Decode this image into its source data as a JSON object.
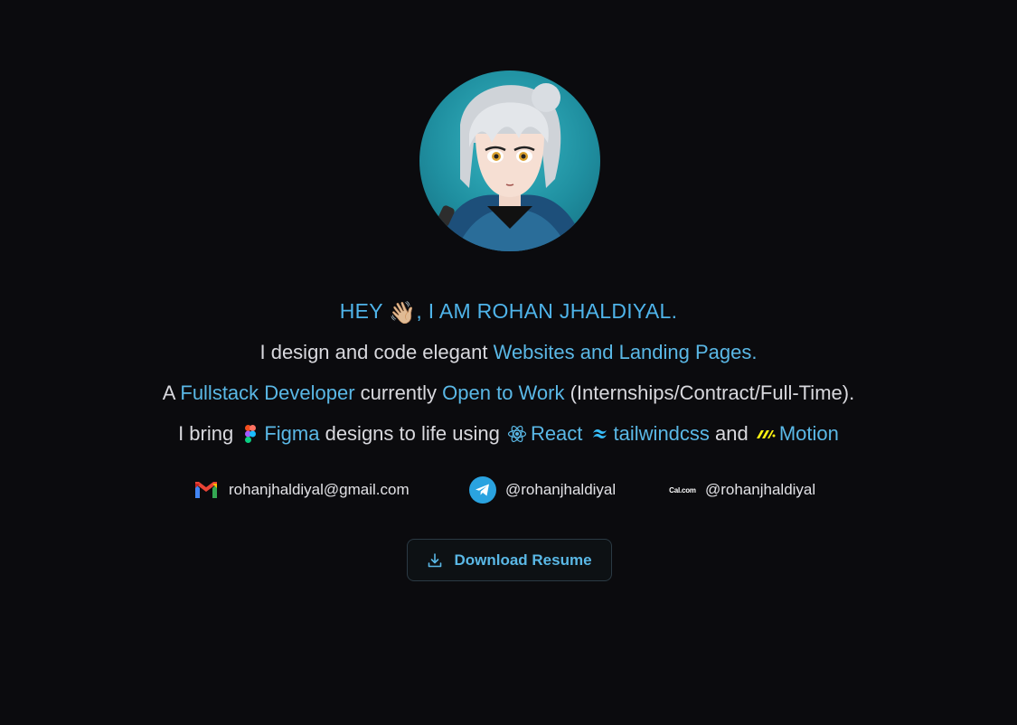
{
  "hero": {
    "greeting_pre": "HEY ",
    "greeting_emoji": "👋🏼",
    "greeting_post": ", I AM ROHAN JHALDIYAL."
  },
  "line2": {
    "text": "I design and code elegant ",
    "accent": "Websites and Landing Pages."
  },
  "line3": {
    "a": "A ",
    "role": "Fullstack Developer",
    "mid": " currently ",
    "status": "Open to Work",
    "tail": " (Internships/Contract/Full-Time)."
  },
  "line4": {
    "a": "I bring ",
    "figma": "Figma",
    "mid": " designs to life using ",
    "react": "React",
    "tailwind": "tailwindcss",
    "and": " and ",
    "motion": "Motion"
  },
  "contacts": {
    "email": {
      "label": "rohanjhaldiyal@gmail.com",
      "icon": "gmail-icon"
    },
    "telegram": {
      "label": "@rohanjhaldiyal",
      "icon": "telegram-icon"
    },
    "cal": {
      "label": "@rohanjhaldiyal",
      "badge": "Cal.com",
      "icon": "cal-icon"
    }
  },
  "resume": {
    "label": "Download Resume",
    "icon": "download-icon"
  },
  "colors": {
    "background": "#0b0b0e",
    "accent": "#5ab8e6",
    "text": "#d9d9de"
  }
}
